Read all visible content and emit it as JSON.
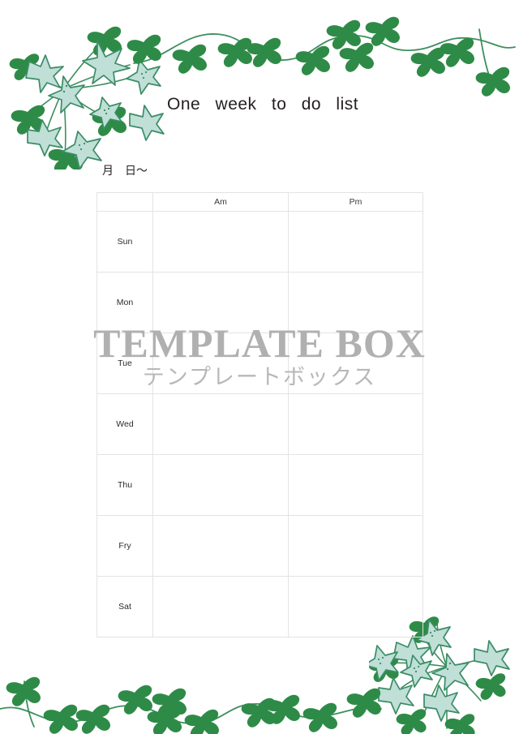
{
  "page": {
    "title": "One  week  to  do  list",
    "date_line": "月　日〜",
    "background_color": "#ffffff"
  },
  "watermark": {
    "main": "TEMPLATE BOX",
    "sub": "テンプレートボックス",
    "color": "#b0b0b0"
  },
  "table": {
    "headers": [
      "",
      "Am",
      "Pm"
    ],
    "rows": [
      {
        "day": "Sun",
        "am": "",
        "pm": ""
      },
      {
        "day": "Mon",
        "am": "",
        "pm": ""
      },
      {
        "day": "Tue",
        "am": "",
        "pm": ""
      },
      {
        "day": "Wed",
        "am": "",
        "pm": ""
      },
      {
        "day": "Thu",
        "am": "",
        "pm": ""
      },
      {
        "day": "Fry",
        "am": "",
        "pm": ""
      },
      {
        "day": "Sat",
        "am": "",
        "pm": ""
      }
    ],
    "border_color": "#e3e3e3"
  },
  "decorations": {
    "top_left": "bellflower-cluster-icon",
    "top_vine": "leaf-vine-icon",
    "bottom_right": "bellflower-cluster-icon",
    "bottom_vine": "leaf-vine-icon",
    "flower_fill": "#bfdfd7",
    "flower_stroke": "#3b8c66",
    "leaf_color": "#2e8b47",
    "stem_color": "#3d8f5e"
  }
}
